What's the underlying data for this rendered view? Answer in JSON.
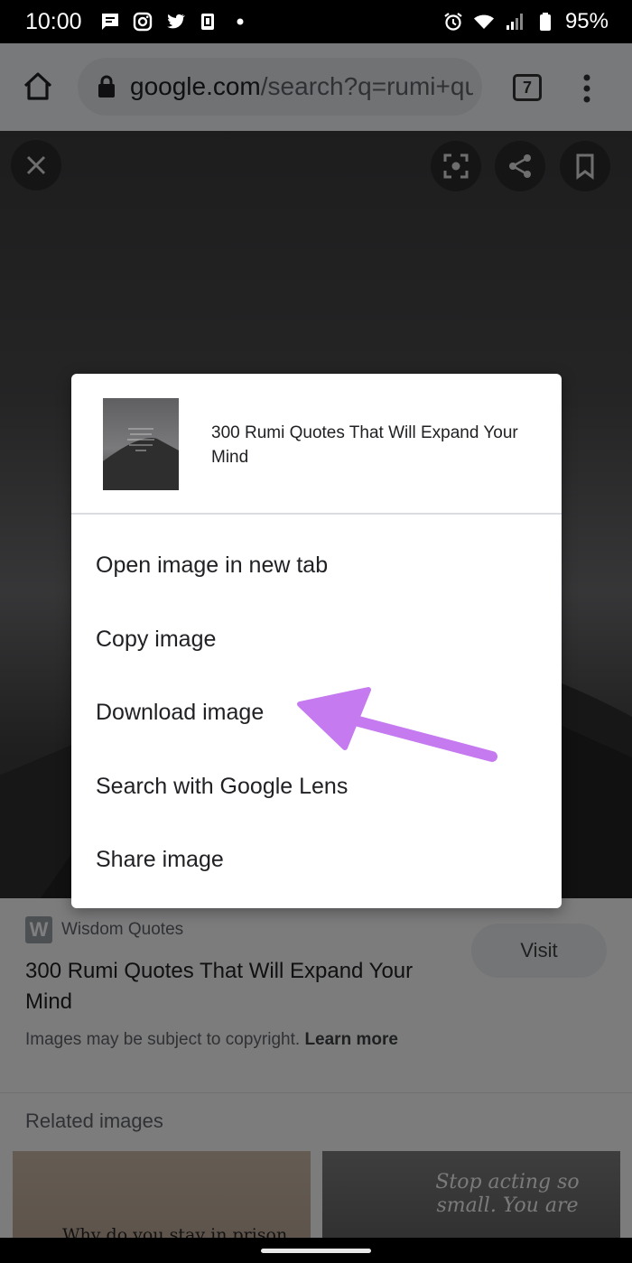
{
  "status_bar": {
    "time": "10:00",
    "left_icons": [
      "message-icon",
      "instagram-icon",
      "twitter-icon",
      "phone-link-icon",
      "dot-icon"
    ],
    "right_icons": [
      "alarm-icon",
      "wifi-icon",
      "signal-icon",
      "battery-icon"
    ],
    "battery": "95%"
  },
  "browser": {
    "url_domain": "google.com",
    "url_path": "/search?q=rumi+qu",
    "tab_count": "7"
  },
  "image_viewer": {
    "buttons": [
      "close-icon",
      "lens-icon",
      "share-icon",
      "bookmark-icon"
    ]
  },
  "result": {
    "site_letter": "W",
    "site_name": "Wisdom Quotes",
    "title": "300 Rumi Quotes That Will Expand Your Mind",
    "visit_label": "Visit",
    "copyright_text": "Images may be subject to copyright.",
    "learn_more": "Learn more"
  },
  "related": {
    "title": "Related images",
    "thumb1_text": "Why do you stay in prison",
    "thumb2_text": "Stop acting so small. You are"
  },
  "context_menu": {
    "title": "300 Rumi Quotes That Will Expand Your Mind",
    "items": [
      "Open image in new tab",
      "Copy image",
      "Download image",
      "Search with Google Lens",
      "Share image"
    ]
  },
  "colors": {
    "annotation_arrow": "#c57af0"
  }
}
